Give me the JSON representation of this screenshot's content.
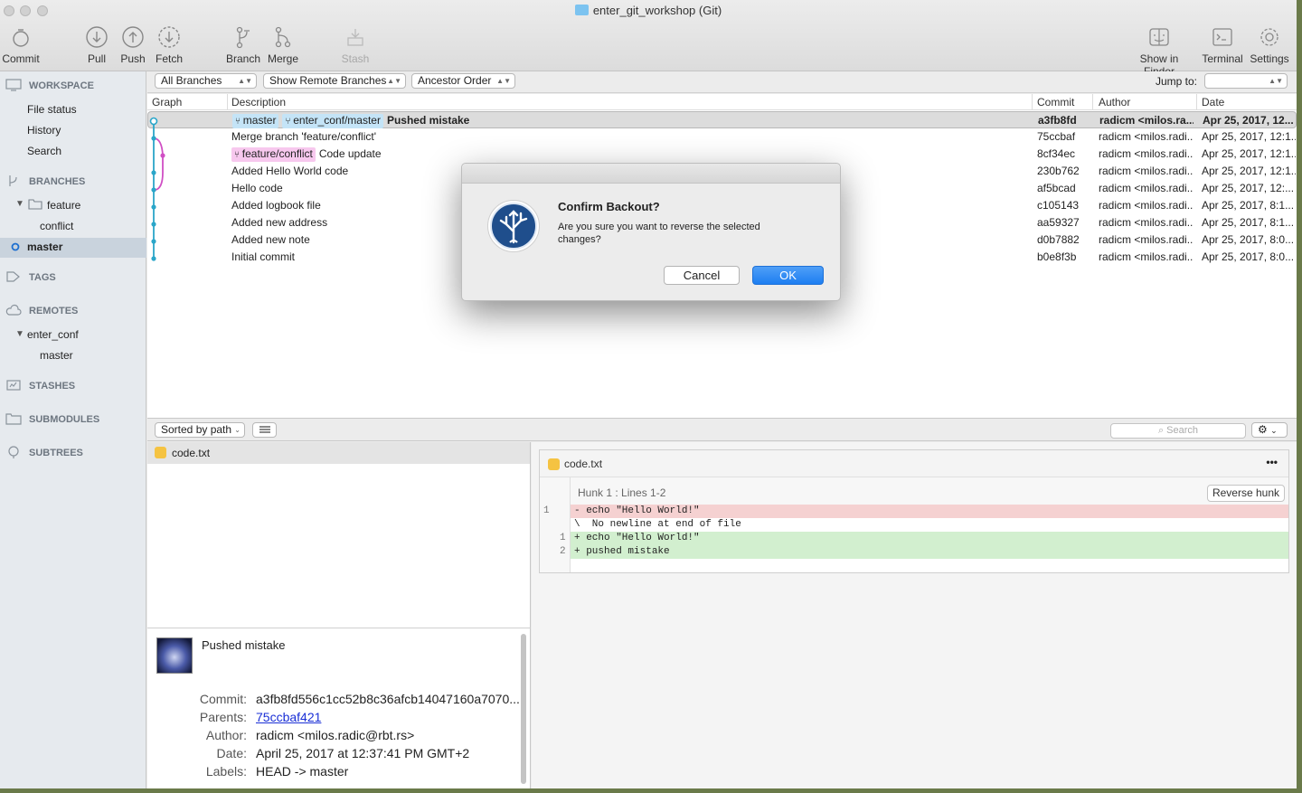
{
  "window": {
    "title": "enter_git_workshop (Git)"
  },
  "toolbar": {
    "commit": "Commit",
    "pull": "Pull",
    "push": "Push",
    "fetch": "Fetch",
    "branch": "Branch",
    "merge": "Merge",
    "stash": "Stash",
    "show_in_finder": "Show in Finder",
    "terminal": "Terminal",
    "settings": "Settings"
  },
  "filters": {
    "branches": "All Branches",
    "remote": "Show Remote Branches",
    "order": "Ancestor Order",
    "jump_to": "Jump to:",
    "jump_value": ""
  },
  "sidebar": {
    "workspace": "WORKSPACE",
    "workspace_items": [
      "File status",
      "History",
      "Search"
    ],
    "branches": "BRANCHES",
    "folder": "feature",
    "folder_item": "conflict",
    "current_branch": "master",
    "tags": "TAGS",
    "remotes": "REMOTES",
    "remote_name": "enter_conf",
    "remote_branch": "master",
    "stashes": "STASHES",
    "submodules": "SUBMODULES",
    "subtrees": "SUBTREES"
  },
  "table": {
    "headers": {
      "graph": "Graph",
      "description": "Description",
      "commit": "Commit",
      "author": "Author",
      "date": "Date"
    },
    "rows": [
      {
        "desc": "Pushed mistake",
        "commit": "a3fb8fd",
        "author": "radicm <milos.ra...",
        "date": "Apr 25, 2017, 12...",
        "tags": [
          "master",
          "enter_conf/master"
        ]
      },
      {
        "desc": "Merge branch 'feature/conflict'",
        "commit": "75ccbaf",
        "author": "radicm <milos.radi...",
        "date": "Apr 25, 2017, 12:1..."
      },
      {
        "desc": "Code update",
        "commit": "8cf34ec",
        "author": "radicm <milos.radi...",
        "date": "Apr 25, 2017, 12:1...",
        "tags": [
          "feature/conflict"
        ]
      },
      {
        "desc": "Added Hello World code",
        "commit": "230b762",
        "author": "radicm <milos.radi...",
        "date": "Apr 25, 2017, 12:1..."
      },
      {
        "desc": "Hello code",
        "commit": "af5bcad",
        "author": "radicm <milos.radi...",
        "date": "Apr 25, 2017, 12:..."
      },
      {
        "desc": "Added logbook file",
        "commit": "c105143",
        "author": "radicm <milos.radi...",
        "date": "Apr 25, 2017, 8:1..."
      },
      {
        "desc": "Added new address",
        "commit": "aa59327",
        "author": "radicm <milos.radi...",
        "date": "Apr 25, 2017, 8:1..."
      },
      {
        "desc": "Added new note",
        "commit": "d0b7882",
        "author": "radicm <milos.radi...",
        "date": "Apr 25, 2017, 8:0..."
      },
      {
        "desc": "Initial commit",
        "commit": "b0e8f3b",
        "author": "radicm <milos.radi...",
        "date": "Apr 25, 2017, 8:0..."
      }
    ]
  },
  "midbar": {
    "sort": "Sorted by path",
    "search_placeholder": "Search"
  },
  "files": [
    "code.txt"
  ],
  "details": {
    "message": "Pushed mistake",
    "commit_label": "Commit:",
    "commit": "a3fb8fd556c1cc52b8c36afcb14047160a7070...",
    "parents_label": "Parents:",
    "parents": "75ccbaf421",
    "author_label": "Author:",
    "author": "radicm <milos.radic@rbt.rs>",
    "date_label": "Date:",
    "date": "April 25, 2017 at 12:37:41 PM GMT+2",
    "labels_label": "Labels:",
    "labels": "HEAD -> master"
  },
  "diff": {
    "file": "code.txt",
    "more": "•••",
    "hunk": "Hunk 1 : Lines 1-2",
    "reverse_hunk": "Reverse hunk",
    "lines": [
      {
        "type": "del",
        "old": "1",
        "new": "",
        "text": "- echo \"Hello World!\""
      },
      {
        "type": "ctx",
        "old": "",
        "new": "",
        "text": "\\  No newline at end of file"
      },
      {
        "type": "add",
        "old": "",
        "new": "1",
        "text": "+ echo \"Hello World!\""
      },
      {
        "type": "add",
        "old": "",
        "new": "2",
        "text": "+ pushed mistake"
      }
    ]
  },
  "dialog": {
    "title": "Confirm Backout?",
    "message": "Are you sure you want to reverse the selected changes?",
    "cancel": "Cancel",
    "ok": "OK"
  },
  "colors": {
    "accent": "#1d7ef1",
    "graph_main": "#2aa6c9",
    "graph_branch": "#d04fc4",
    "selection": "#c9d3dd"
  }
}
